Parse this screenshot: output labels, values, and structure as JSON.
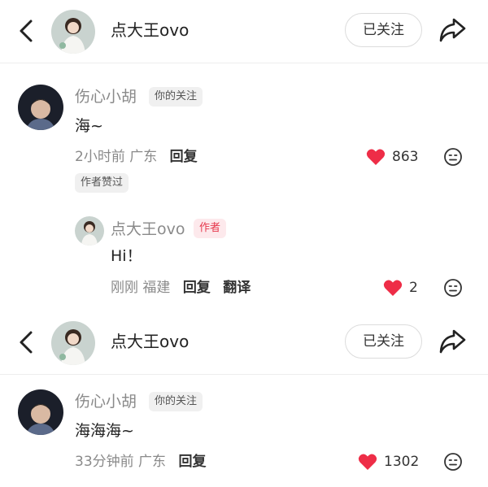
{
  "header": {
    "user_name": "点大王ovo",
    "follow_label": "已关注"
  },
  "comments": [
    {
      "user_name": "伤心小胡",
      "badge": "你的关注",
      "text": "海~",
      "time": "2小时前",
      "location": "广东",
      "reply_label": "回复",
      "likes": "863",
      "liked_by_author": "作者赞过",
      "reply": {
        "user_name": "点大王ovo",
        "badge": "作者",
        "text": "Hi！",
        "time": "刚刚",
        "location": "福建",
        "reply_label": "回复",
        "translate_label": "翻译",
        "likes": "2"
      }
    },
    {
      "user_name": "伤心小胡",
      "badge": "你的关注",
      "text": "海海海~",
      "time": "33分钟前",
      "location": "广东",
      "reply_label": "回复",
      "likes": "1302"
    }
  ],
  "colors": {
    "like_red": "#ee2d47",
    "author_badge": "#e6394d"
  },
  "icons": [
    "back-icon",
    "share-icon",
    "heart-icon",
    "emoji-icon"
  ]
}
